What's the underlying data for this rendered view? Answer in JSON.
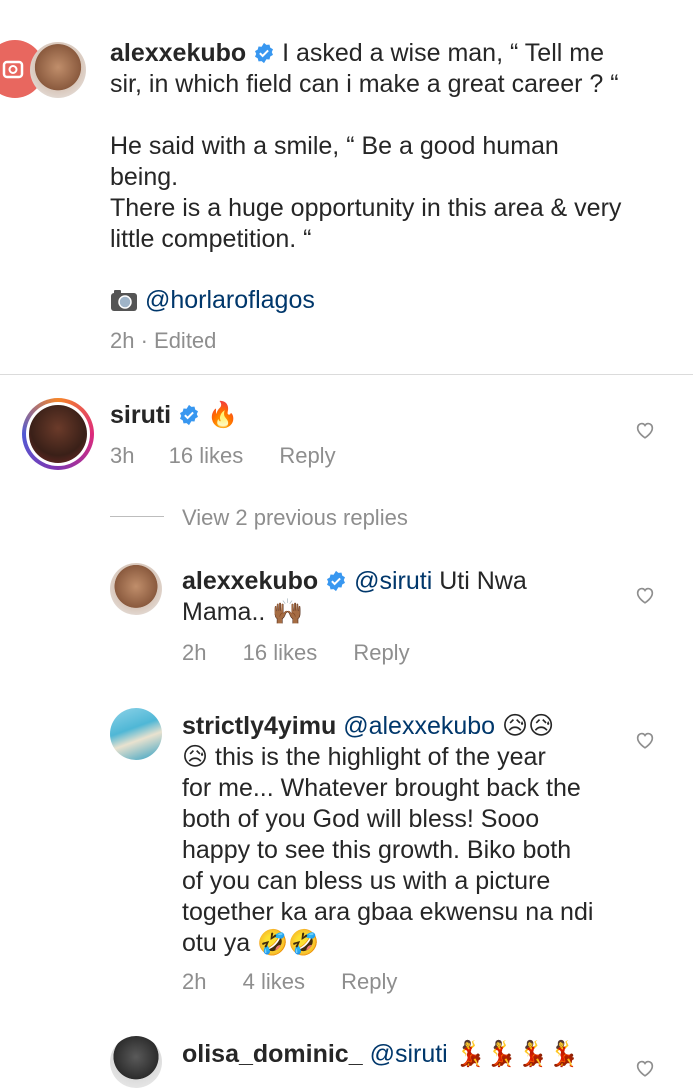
{
  "caption": {
    "username": "alexxekubo",
    "line1": "I asked a wise man, “ Tell me",
    "line2": "sir, in which field can i make a great career ? “",
    "line3": "He said with a smile, “ Be a good human",
    "line4": "being.",
    "line5": "There is a huge opportunity in this area & very",
    "line6": "little competition. “",
    "credit": "@horlaroflagos",
    "meta": "2h · Edited"
  },
  "comment_siruti": {
    "username": "siruti",
    "emoji": "🔥",
    "time": "3h",
    "likes": "16 likes",
    "reply": "Reply"
  },
  "view_replies": "View 2 previous replies",
  "reply_alex": {
    "username": "alexxekubo",
    "mention": "@siruti",
    "text1": "Uti Nwa",
    "text2": "Mama..",
    "emoji": "🙌🏾",
    "time": "2h",
    "likes": "16 likes",
    "reply": "Reply"
  },
  "reply_strictly": {
    "username": "strictly4yimu",
    "mention": "@alexxekubo",
    "emoji1": "😥😥",
    "emoji2": "😥",
    "line1": "this is the highlight of the year",
    "line2": "for me... Whatever brought back the",
    "line3": "both of you God will bless! Sooo",
    "line4": "happy to see this growth. Biko both",
    "line5": "of you can bless us with a picture",
    "line6": "together ka ara gbaa ekwensu na ndi",
    "line7": "otu ya",
    "emoji3": "🤣🤣",
    "time": "2h",
    "likes": "4 likes",
    "reply": "Reply"
  },
  "reply_olisa": {
    "username": "olisa_dominic_",
    "mention": "@siruti",
    "emoji": "💃💃💃💃"
  },
  "colors": {
    "verified": "#3897f0",
    "meta": "#8e8e8e",
    "mention": "#00376b",
    "divider": "#dbdbdb"
  }
}
